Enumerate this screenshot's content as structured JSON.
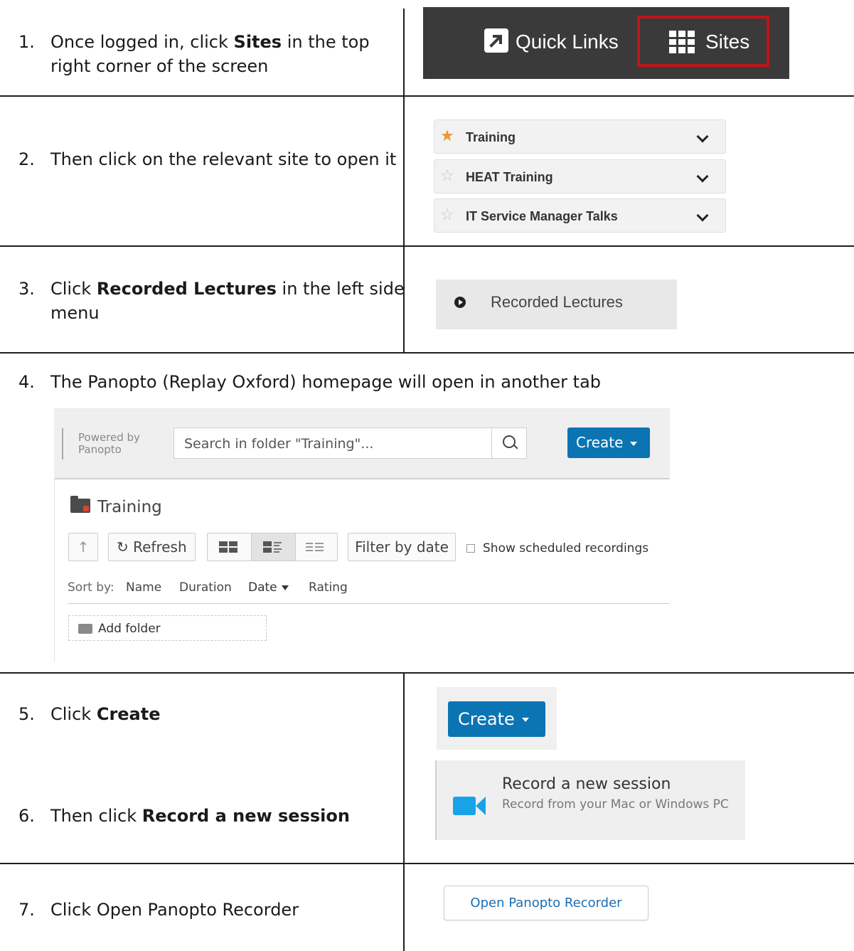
{
  "steps": [
    {
      "num": "1.",
      "pre": "Once logged in, click ",
      "bold": "Sites",
      "post": " in the top",
      "cont": "right corner of the screen"
    },
    {
      "num": "2.",
      "text": "Then click on the relevant site to open it"
    },
    {
      "num": "3.",
      "pre": "Click ",
      "bold": "Recorded Lectures",
      "post": " in the left side",
      "cont": "menu"
    },
    {
      "num": "4.",
      "text": "The Panopto (Replay Oxford) homepage will open in another tab"
    },
    {
      "num": "5.",
      "pre": "Click ",
      "bold": "Create"
    },
    {
      "num": "6.",
      "pre": "Then click ",
      "bold": "Record a new session"
    },
    {
      "num": "7.",
      "text": "Click Open Panopto Recorder"
    }
  ],
  "topbar": {
    "quick_links": "Quick Links",
    "sites": "Sites",
    "highlight_color": "#c0141a"
  },
  "site_list": [
    {
      "label": "Training",
      "starred": true
    },
    {
      "label": "HEAT Training",
      "starred": false
    },
    {
      "label": "IT Service Manager Talks",
      "starred": false
    }
  ],
  "recorded_lectures": {
    "label": "Recorded Lectures"
  },
  "panopto": {
    "powered_by_line1": "Powered by",
    "powered_by_line2": "Panopto",
    "search_placeholder": "Search in folder \"Training\"...",
    "create_label": "Create",
    "folder_title": "Training",
    "refresh_label": "Refresh",
    "filter_label": "Filter by date",
    "show_scheduled": "Show scheduled recordings",
    "sort_by": "Sort by:",
    "sort_options": [
      "Name",
      "Duration",
      "Date",
      "Rating"
    ],
    "add_folder": "Add folder",
    "accent_color": "#0b74b3"
  },
  "create_zoom": {
    "label": "Create"
  },
  "record_session": {
    "title": "Record a new session",
    "subtitle": "Record from your Mac or Windows PC",
    "icon_color": "#18a3e8"
  },
  "open_recorder": {
    "label": "Open Panopto Recorder"
  }
}
